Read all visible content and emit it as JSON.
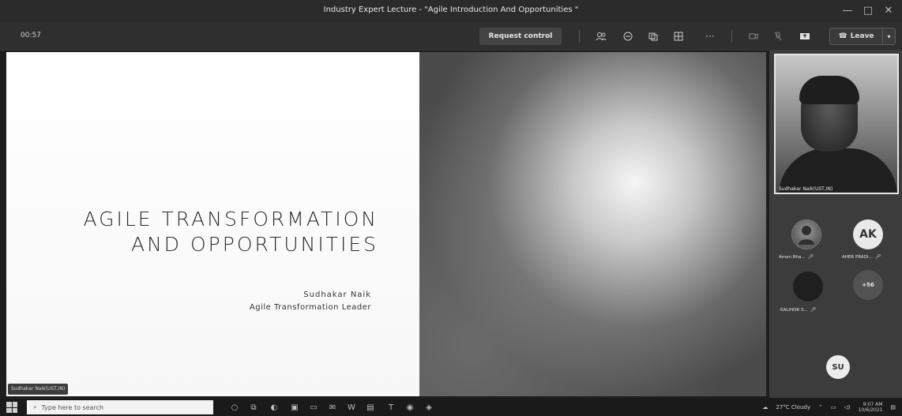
{
  "window": {
    "title": "Industry Expert Lecture - \"Agile Introduction And Opportunities \"",
    "controls": [
      "—",
      "□",
      "✕"
    ]
  },
  "toolbar": {
    "timer": "00:57",
    "request_control": "Request control",
    "leave": "Leave",
    "leave_caret": "▾",
    "icons": [
      "participants-icon",
      "chat-icon",
      "reactions-icon",
      "rooms-icon",
      "more-icon",
      "camera-off-icon",
      "mic-off-icon",
      "share-icon"
    ]
  },
  "slide": {
    "title_line1": "AGILE TRANSFORMATION",
    "title_line2": "AND OPPORTUNITIES",
    "presenter_name": "Sudhakar Naik",
    "presenter_role": "Agile Transformation Leader"
  },
  "speaker_tag": "Sudhakar Naik(UST,IN)",
  "panel": {
    "main_video_label": "Sudhakar Naik(UST,IN)",
    "participants": [
      {
        "label": "Aman Bha...",
        "initials": ""
      },
      {
        "label": "AHER PRADI...",
        "initials": "AK"
      },
      {
        "label": "KALIHOR S...",
        "initials": ""
      },
      {
        "label": "",
        "initials": "+56"
      },
      {
        "label": "",
        "initials": "SU"
      }
    ]
  },
  "taskbar": {
    "search_placeholder": "Type here to search",
    "weather": "27°C Cloudy",
    "time": "9:07 AM",
    "date": "10/6/2021"
  }
}
